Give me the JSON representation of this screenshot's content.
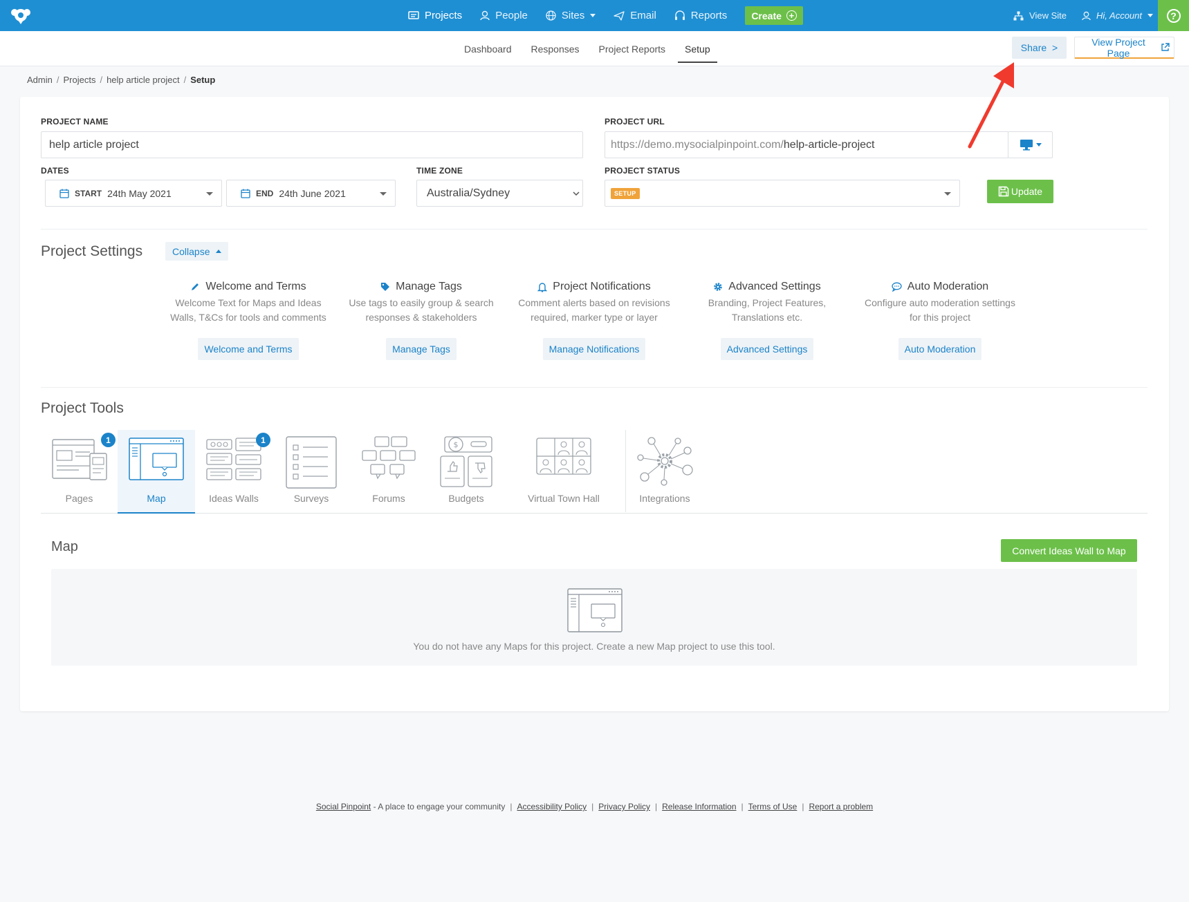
{
  "nav": {
    "items": [
      {
        "label": "Projects",
        "icon": "projects-icon"
      },
      {
        "label": "People",
        "icon": "person-icon"
      },
      {
        "label": "Sites",
        "icon": "globe-icon"
      },
      {
        "label": "Email",
        "icon": "paper-plane-icon"
      },
      {
        "label": "Reports",
        "icon": "headset-icon"
      }
    ],
    "create_label": "Create",
    "view_site_label": "View Site",
    "account_label": "Hi, Account",
    "help_label": "?"
  },
  "subnav": {
    "tabs": [
      "Dashboard",
      "Responses",
      "Project Reports",
      "Setup"
    ],
    "active_tab": "Setup",
    "share_label": "Share",
    "view_project_label": "View Project Page"
  },
  "breadcrumb": [
    "Admin",
    "Projects",
    "help article project",
    "Setup"
  ],
  "form": {
    "project_name_label": "PROJECT NAME",
    "project_name_value": "help article project",
    "project_url_label": "PROJECT URL",
    "project_url_prefix": "https://demo.mysocialpinpoint.com/",
    "project_url_slug": "help-article-project",
    "dates_label": "DATES",
    "start_label": "START",
    "start_value": "24th May 2021",
    "end_label": "END",
    "end_value": "24th June 2021",
    "timezone_label": "TIME ZONE",
    "timezone_value": "Australia/Sydney",
    "status_label": "PROJECT STATUS",
    "status_badge": "SETUP",
    "update_label": "Update"
  },
  "settings": {
    "title": "Project Settings",
    "collapse_label": "Collapse",
    "items": [
      {
        "title": "Welcome and Terms",
        "desc1": "Welcome Text for Maps and Ideas",
        "desc2": "Walls, T&Cs for tools and comments",
        "button": "Welcome and Terms",
        "icon": "pencil-icon"
      },
      {
        "title": "Manage Tags",
        "desc1": "Use tags to easily group & search",
        "desc2": "responses & stakeholders",
        "button": "Manage Tags",
        "icon": "tag-icon"
      },
      {
        "title": "Project Notifications",
        "desc1": "Comment alerts based on revisions",
        "desc2": "required, marker type or layer",
        "button": "Manage Notifications",
        "icon": "bell-icon"
      },
      {
        "title": "Advanced Settings",
        "desc1": "Branding, Project Features,",
        "desc2": "Translations etc.",
        "button": "Advanced Settings",
        "icon": "gear-icon"
      },
      {
        "title": "Auto Moderation",
        "desc1": "Configure auto moderation settings",
        "desc2": "for this project",
        "button": "Auto Moderation",
        "icon": "chat-bubble-icon"
      }
    ]
  },
  "tools": {
    "title": "Project Tools",
    "items": [
      {
        "label": "Pages",
        "badge": "1"
      },
      {
        "label": "Map",
        "badge": ""
      },
      {
        "label": "Ideas Walls",
        "badge": "1"
      },
      {
        "label": "Surveys",
        "badge": ""
      },
      {
        "label": "Forums",
        "badge": ""
      },
      {
        "label": "Budgets",
        "badge": ""
      },
      {
        "label": "Virtual Town Hall",
        "badge": ""
      },
      {
        "label": "Integrations",
        "badge": ""
      }
    ],
    "active_tool": "Map"
  },
  "map_panel": {
    "title": "Map",
    "convert_label": "Convert Ideas Wall to Map",
    "empty_text": "You do not have any Maps for this project. Create a new Map project to use this tool."
  },
  "footer": {
    "brand": "Social Pinpoint",
    "tagline": " - A place to engage your community",
    "links": [
      "Accessibility Policy",
      "Privacy Policy",
      "Release Information",
      "Terms of Use",
      "Report a problem"
    ]
  },
  "colors": {
    "primary": "#1f8fd3",
    "link": "#1b83c9",
    "success": "#6cc04a",
    "badge_orange": "#f0a33a",
    "annotation_arrow": "#f03a2e"
  }
}
